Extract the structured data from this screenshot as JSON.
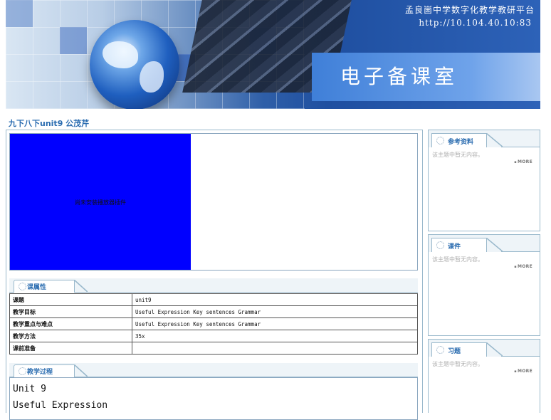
{
  "banner": {
    "school_name": "孟良崮中学数字化教学教研平台",
    "server_address": "http://10.104.40.10:83",
    "title": "电子备课室"
  },
  "lesson": {
    "title": "九下八下unit9  公茂芹"
  },
  "viewer": {
    "message": "尚未安装播放器插件"
  },
  "properties": {
    "heading": "课属性",
    "rows": [
      {
        "key": "课题",
        "value": "unit9"
      },
      {
        "key": "教学目标",
        "value": "Useful Expression Key sentences Grammar"
      },
      {
        "key": "教学重点与难点",
        "value": "Useful Expression Key sentences Grammar"
      },
      {
        "key": "教学方法",
        "value": "35x"
      },
      {
        "key": "课前准备",
        "value": ""
      }
    ]
  },
  "process": {
    "heading": "教学过程",
    "lines": [
      "Unit 9",
      "Useful Expression"
    ]
  },
  "sidebar": [
    {
      "title": "参考资料",
      "empty_text": "该主题中暂无内容。",
      "more_label": "MORE"
    },
    {
      "title": "课件",
      "empty_text": "该主题中暂无内容。",
      "more_label": "MORE"
    },
    {
      "title": "习题",
      "empty_text": "该主题中暂无内容。",
      "more_label": "MORE"
    }
  ],
  "colors": {
    "accent": "#2a6cb0",
    "border": "#9ab9cc",
    "player_bg": "#0000ff"
  }
}
